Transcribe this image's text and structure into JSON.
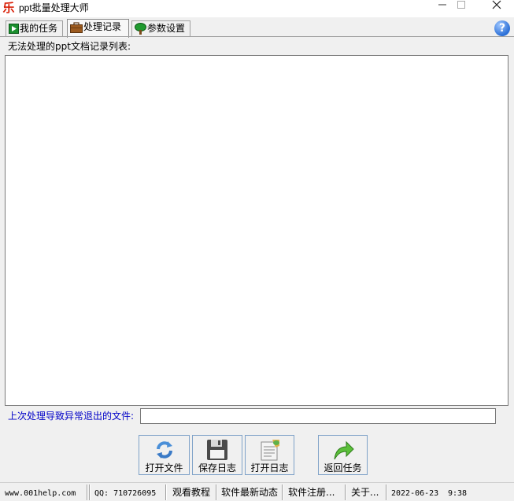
{
  "window": {
    "title": "ppt批量处理大师",
    "app_icon_char": "乐",
    "brand_color": "#d81e06"
  },
  "tabs": [
    {
      "label": "我的任务",
      "icon": "play-icon"
    },
    {
      "label": "处理记录",
      "icon": "briefcase-icon",
      "active": true
    },
    {
      "label": "参数设置",
      "icon": "tree-icon"
    }
  ],
  "help": {
    "glyph": "?"
  },
  "records": {
    "list_label": "无法处理的ppt文档记录列表:",
    "items": []
  },
  "last_crash": {
    "label": "上次处理导致异常退出的文件:",
    "value": "",
    "label_color": "#0000c8"
  },
  "buttons": {
    "open_file": "打开文件",
    "save_log": "保存日志",
    "open_log": "打开日志",
    "return_tasks": "返回任务"
  },
  "status_bar": {
    "website": "www.001help.com",
    "qq": "QQ: 710726095",
    "tutorial": "观看教程",
    "news": "软件最新动态",
    "register": "软件注册...",
    "about": "关于...",
    "date": "2022-06-23",
    "time": "9:38"
  }
}
